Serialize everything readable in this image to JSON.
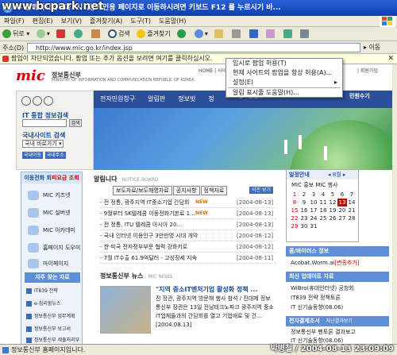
{
  "window": {
    "title": "부 홈페이지입니다. 시각장애인용 페이지로 이동하시려면 키보드 F12 를 누르시기 바..."
  },
  "watermark": "www.bcpark.net",
  "menu": [
    "파일(F)",
    "편집(E)",
    "보기(V)",
    "즐겨찾기(A)",
    "도구(T)",
    "도움말(H)"
  ],
  "toolbar": {
    "back": "뒤로",
    "search": "검색",
    "favorites": "즐겨찾기"
  },
  "address": {
    "label": "주소(D)",
    "url": "http://www.mic.go.kr/index.jsp",
    "go": "이동"
  },
  "infobar": {
    "text": "팝업이 차단되었습니다. 팝업 또는 추가 옵션을 보려면 여기를 클릭하십시오."
  },
  "popup": {
    "items": [
      "임시로 팝업 허용(T)",
      "현재 사이트의 팝업을 항상 허용(A)...",
      "설정(E)",
      "알림 표시줄 도움말(H)..."
    ]
  },
  "site": {
    "logo": "mic",
    "ministry": "정보통신부",
    "ministry_en": "MINISTRY OF INFORMATION AND COMMUNICATION REPUBLIC OF KOREA",
    "toplinks": "HOME | 사이",
    "toplinks_right": "| 회원가입",
    "nav": [
      "전자민원창구",
      "알림판",
      "정보빗",
      "정"
    ],
    "nav_right": "정보통신부 ms",
    "nav_ad": "민원수기",
    "search_title": "IT 통합 정보검색",
    "search_btn": "검색",
    "search_title2": "국내사이트 검색",
    "select_value": "국내 바로가기",
    "search_btns": [
      "국내이동",
      "국내주소"
    ]
  },
  "sidebar": {
    "header": "이동전화 회",
    "header_em": "피요금 조회",
    "items": [
      "MIC 키즈넷",
      "MIC 실버넷",
      "MIC 아카데미",
      "홈페이지 도우미",
      "마이페이지"
    ],
    "fav_title": "자주 찾는 자료",
    "fav_items": [
      "IT839 전략",
      "e-집리함뉴스",
      "정보통신부 업무계획",
      "정보통신부 보고서",
      "정보통신부 세출처리부"
    ]
  },
  "news": {
    "title": "알림니다",
    "sub": "NOTICE BOARD",
    "tabs": [
      "보도자료/보도해명자료",
      "공지사항",
      "정책자료"
    ],
    "more": "이전 보기",
    "rows": [
      {
        "t": "- 전 정통, 광주지역 IT중소기업 간담회",
        "n": "NEW",
        "d": "[2004-08-13]"
      },
      {
        "t": "- 9월부터 SK텔레콤 이동전화기본료 1...",
        "n": "NEW",
        "d": "[2004-08-13]"
      },
      {
        "t": "- 전 정통, ITU 텔레콤 아시아 20...",
        "n": "",
        "d": "[2004-08-13]"
      },
      {
        "t": "- 국내 인터넷 이용인구 3만만명 시대 개막",
        "n": "",
        "d": "[2004-08-12]"
      },
      {
        "t": "- 한·미국 전자정부부문 협력 강화키로",
        "n": "",
        "d": "[2004-08-12]"
      },
      {
        "t": "- 7월 IT수출 61.9억달러 - 고성장세 지속",
        "n": "",
        "d": "[2004-08-11]"
      }
    ]
  },
  "news2": {
    "title": "정보통신부 뉴스",
    "sub": "MIC NEWS",
    "headline": "\"지역 중소IT벤처기업 활성화 정책 ...",
    "body": "진 장관, 광주지역 방문해 행사 참석 / 진대제 정보통신부 장관은 13일 전남테크노파크 광주지역 중소IT업체들과의 간담회를 열고 기업애로 및 건... [2004.08.13]"
  },
  "calendar": {
    "title": "일정안내",
    "month": "8월",
    "tabs": "MIC 홍보  MIC 행사",
    "weeks": [
      [
        "1",
        "2",
        "3",
        "4",
        "5",
        "6",
        "7"
      ],
      [
        "8",
        "9",
        "10",
        "11",
        "12",
        "13",
        "14"
      ],
      [
        "15",
        "16",
        "17",
        "18",
        "19",
        "20",
        "21"
      ],
      [
        "22",
        "23",
        "24",
        "25",
        "26",
        "27",
        "28"
      ],
      [
        "29",
        "30",
        "31",
        "",
        "",
        "",
        "",
        ""
      ]
    ],
    "today": "13"
  },
  "right": {
    "blog_head": "콤/바이러스 정보",
    "blog_item": "Acobat.Worm.ai",
    "blog_item_red": "[변종추가]",
    "update_head": "최신 업데이트 자료",
    "update_items": [
      "WiBro(휴대인터넷) 공청회",
      "IT839 전략 정책토론",
      "IT 신기술동향(08.06)"
    ],
    "mgmt_head": "전자결제조서",
    "mgmt_more": "자난결과보기",
    "mgmt_items": [
      "정보통신부 펜토론 결과보고",
      "IT 신기술동향(08.06)"
    ]
  },
  "status": {
    "text": "정보통신부 홈페이지입니다.",
    "stamp": "박병철 / 2004-08-13 23:09:09"
  }
}
